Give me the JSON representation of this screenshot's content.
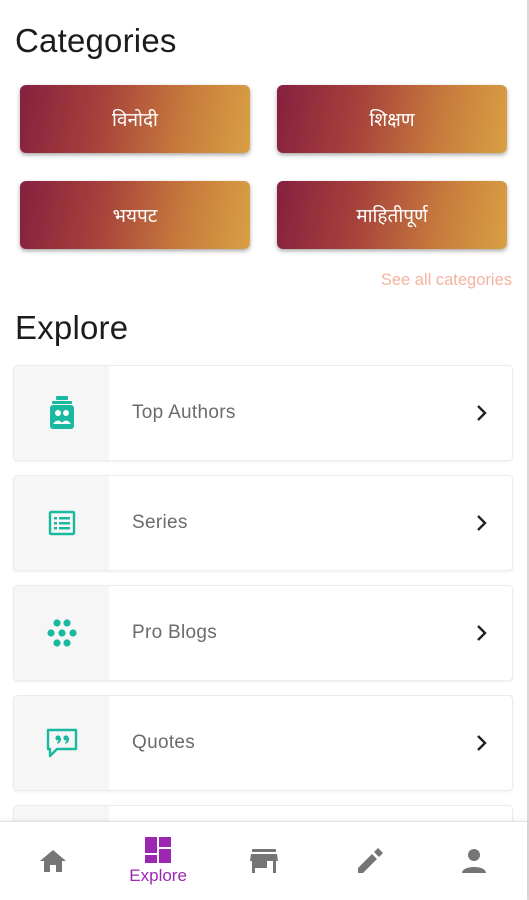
{
  "categories": {
    "title": "Categories",
    "items": [
      {
        "label": "विनोदी"
      },
      {
        "label": "शिक्षण"
      },
      {
        "label": "भयपट"
      },
      {
        "label": "माहितीपूर्ण"
      }
    ],
    "see_all": "See all categories"
  },
  "explore": {
    "title": "Explore",
    "items": [
      {
        "label": "Top Authors",
        "icon": "authors-icon"
      },
      {
        "label": "Series",
        "icon": "list-icon"
      },
      {
        "label": "Pro Blogs",
        "icon": "dots-cluster-icon"
      },
      {
        "label": "Quotes",
        "icon": "quote-bubble-icon"
      }
    ]
  },
  "bottom_nav": {
    "items": [
      {
        "icon": "home-icon",
        "label": ""
      },
      {
        "icon": "explore-icon",
        "label": "Explore",
        "active": true
      },
      {
        "icon": "store-icon",
        "label": ""
      },
      {
        "icon": "pencil-icon",
        "label": ""
      },
      {
        "icon": "person-icon",
        "label": ""
      }
    ]
  },
  "colors": {
    "accent_teal": "#19b9a0",
    "active_nav": "#9c27b0",
    "inactive_nav": "#757575",
    "see_all": "#f4b39f",
    "gradient_start": "#85203f",
    "gradient_end": "#d9a043"
  }
}
